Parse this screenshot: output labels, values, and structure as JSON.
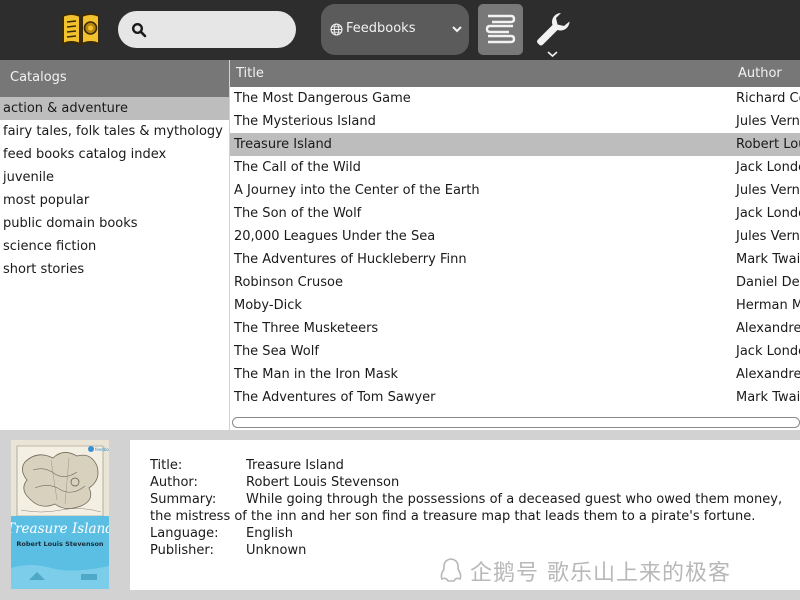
{
  "toolbar": {
    "search": {
      "value": "",
      "placeholder": ""
    },
    "catalog_select": {
      "selected": "Feedbooks"
    }
  },
  "sidebar": {
    "header": "Catalogs",
    "items": [
      {
        "label": "action & adventure",
        "selected": true
      },
      {
        "label": "fairy tales, folk tales & mythology"
      },
      {
        "label": "feed books catalog index"
      },
      {
        "label": "juvenile"
      },
      {
        "label": "most popular"
      },
      {
        "label": "public domain books"
      },
      {
        "label": "science fiction"
      },
      {
        "label": "short stories"
      }
    ]
  },
  "table": {
    "columns": [
      "Title",
      "Author"
    ],
    "rows": [
      {
        "title": "The Most Dangerous Game",
        "author": "Richard Co"
      },
      {
        "title": "The Mysterious Island",
        "author": "Jules Vern"
      },
      {
        "title": "Treasure Island",
        "author": "Robert Lou",
        "selected": true
      },
      {
        "title": "The Call of the Wild",
        "author": "Jack Londo"
      },
      {
        "title": "A Journey into the Center of the Earth",
        "author": "Jules Vern"
      },
      {
        "title": "The Son of the Wolf",
        "author": "Jack Londo"
      },
      {
        "title": "20,000 Leagues Under the Sea",
        "author": "Jules Vern"
      },
      {
        "title": "The Adventures of Huckleberry Finn",
        "author": "Mark Twai"
      },
      {
        "title": "Robinson Crusoe",
        "author": "Daniel De"
      },
      {
        "title": "Moby-Dick",
        "author": "Herman M"
      },
      {
        "title": "The Three Musketeers",
        "author": "Alexandre"
      },
      {
        "title": "The Sea Wolf",
        "author": "Jack Londo"
      },
      {
        "title": "The Man in the Iron Mask",
        "author": "Alexandre"
      },
      {
        "title": "The Adventures of Tom Sawyer",
        "author": "Mark Twai"
      }
    ]
  },
  "details": {
    "cover": {
      "title": "Treasure Island",
      "author": "Robert Louis Stevenson",
      "publisher_mark": "feedbooks"
    },
    "title_label": "Title:",
    "title": "Treasure Island",
    "author_label": "Author:",
    "author": "Robert Louis Stevenson",
    "summary_label": "Summary:",
    "summary": "While going through the possessions of a deceased guest who owed them money,",
    "summary_cont": "the mistress of the inn and her son find a treasure map that leads them to a pirate's fortune.",
    "language_label": "Language:",
    "language": "English",
    "publisher_label": "Publisher:",
    "publisher": "Unknown"
  },
  "watermark": "企鹅号 歌乐山上来的极客",
  "colors": {
    "toolbar_bg": "#2d2d2d",
    "header_bg": "#777777",
    "selection": "#bdbdbd",
    "logo_yellow": "#f2c12e",
    "cover_blue": "#5bbfe3"
  }
}
